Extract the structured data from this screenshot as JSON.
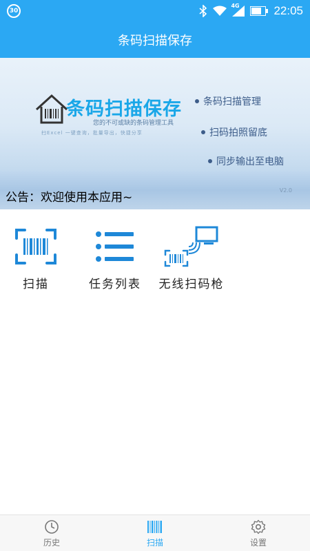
{
  "status_bar": {
    "badge": "30",
    "network": "4G",
    "time": "22:05"
  },
  "header": {
    "title": "条码扫描保存"
  },
  "banner": {
    "title": "条码扫描保存",
    "subtitle": "您的不可或缺的条码管理工具",
    "tagline": "扫Excel 一键查询，批量导出，快捷分享",
    "features": [
      "条码扫描管理",
      "扫码拍照留底",
      "同步输出至电脑"
    ],
    "version": "V2.0"
  },
  "announcement": "公告：欢迎使用本应用~",
  "tools": [
    {
      "label": "扫描",
      "icon": "barcode-scan-icon"
    },
    {
      "label": "任务列表",
      "icon": "list-icon"
    },
    {
      "label": "无线扫码枪",
      "icon": "wireless-scanner-icon"
    }
  ],
  "bottom_nav": [
    {
      "label": "历史",
      "icon": "clock-icon",
      "active": false
    },
    {
      "label": "扫描",
      "icon": "barcode-icon",
      "active": true
    },
    {
      "label": "设置",
      "icon": "gear-icon",
      "active": false
    }
  ],
  "colors": {
    "primary": "#2ba8f3",
    "banner_title": "#1aa7e8"
  }
}
